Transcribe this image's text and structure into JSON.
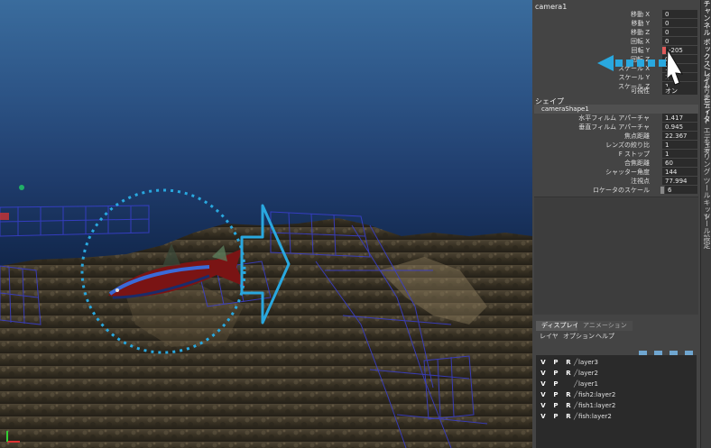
{
  "viewport": {
    "annotation_color": "#29a8df"
  },
  "channel_box": {
    "object_name": "camera1",
    "transform_attrs": [
      {
        "label": "移動 X",
        "value": "0"
      },
      {
        "label": "移動 Y",
        "value": "0"
      },
      {
        "label": "移動 Z",
        "value": "0"
      },
      {
        "label": "回転 X",
        "value": "0"
      },
      {
        "label": "回転 Y",
        "value": "-205"
      },
      {
        "label": "回転 Z",
        "value": "0"
      },
      {
        "label": "スケール X",
        "value": "1"
      },
      {
        "label": "スケール Y",
        "value": "1"
      },
      {
        "label": "スケール Z",
        "value": "1"
      },
      {
        "label": "可視性",
        "value": "オン"
      }
    ],
    "shape_section_label": "シェイプ",
    "shape_name": "cameraShape1",
    "shape_attrs": [
      {
        "label": "水平フィルム アパーチャ",
        "value": "1.417"
      },
      {
        "label": "垂直フィルム アパーチャ",
        "value": "0.945"
      },
      {
        "label": "焦点距離",
        "value": "22.367"
      },
      {
        "label": "レンズの絞り比",
        "value": "1"
      },
      {
        "label": "F ストップ",
        "value": "1"
      },
      {
        "label": "合焦距離",
        "value": "60"
      },
      {
        "label": "シャッター角度",
        "value": "144"
      },
      {
        "label": "注視点",
        "value": "77.994"
      },
      {
        "label": "ロケータのスケール",
        "value": "6"
      }
    ]
  },
  "side_tabs": [
    "チャンネル ボックス/レイヤ エディタ",
    "アトリビュート エディタ",
    "モデリング ツールキット",
    "ツール設定"
  ],
  "layer_editor": {
    "tabs": [
      "ディスプレイ",
      "アニメーション"
    ],
    "menu": [
      "レイヤ",
      "オプション",
      "ヘルプ"
    ],
    "layers": [
      {
        "v": "V",
        "p": "P",
        "r": "R",
        "name": "layer3"
      },
      {
        "v": "V",
        "p": "P",
        "r": "R",
        "name": "layer2"
      },
      {
        "v": "V",
        "p": "P",
        "r": "",
        "name": "layer1"
      },
      {
        "v": "V",
        "p": "P",
        "r": "R",
        "name": "fish2:layer2"
      },
      {
        "v": "V",
        "p": "P",
        "r": "R",
        "name": "fish1:layer2"
      },
      {
        "v": "V",
        "p": "P",
        "r": "R",
        "name": "fish:layer2"
      }
    ]
  }
}
